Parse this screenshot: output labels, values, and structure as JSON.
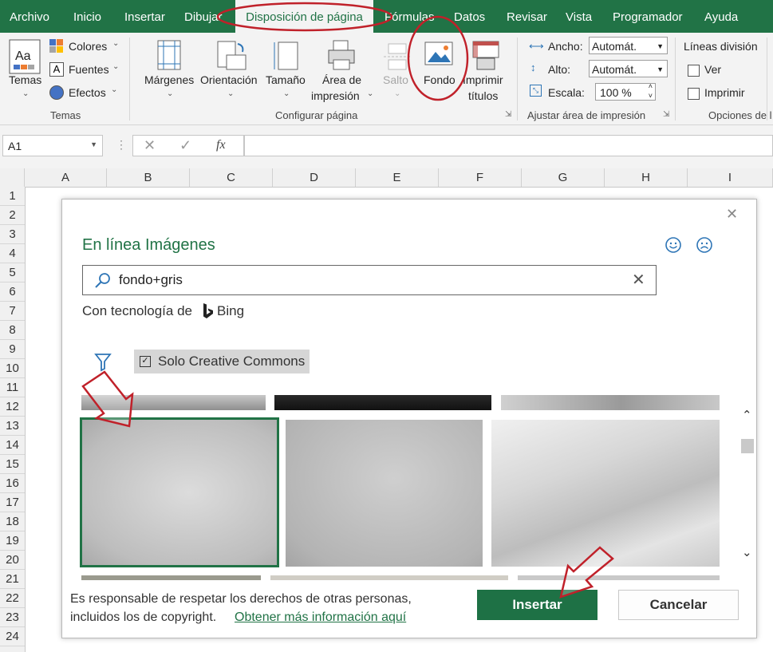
{
  "tabs": [
    "Archivo",
    "Inicio",
    "Insertar",
    "Dibujar",
    "Disposición de página",
    "Fórmulas",
    "Datos",
    "Revisar",
    "Vista",
    "Programador",
    "Ayuda"
  ],
  "ribbon": {
    "themes": {
      "label": "Temas",
      "colors": "Colores",
      "fonts": "Fuentes",
      "effects": "Efectos",
      "group": "Temas"
    },
    "page_setup": {
      "margins": "Márgenes",
      "orientation": "Orientación",
      "size": "Tamaño",
      "print_area_1": "Área de",
      "print_area_2": "impresión",
      "breaks": "Salto",
      "background": "Fondo",
      "print_titles_1": "Imprimir",
      "print_titles_2": "títulos",
      "group": "Configurar página"
    },
    "scale_fit": {
      "width_label": "Ancho:",
      "width_value": "Automát.",
      "height_label": "Alto:",
      "height_value": "Automát.",
      "scale_label": "Escala:",
      "scale_value": "100 %",
      "group": "Ajustar área de impresión"
    },
    "sheet_options": {
      "gridlines": "Líneas división",
      "view": "Ver",
      "print": "Imprimir",
      "group": "Opciones de l"
    }
  },
  "formula_bar": {
    "name_box": "A1",
    "fx": "fx"
  },
  "columns": [
    "A",
    "B",
    "C",
    "D",
    "E",
    "F",
    "G",
    "H",
    "I"
  ],
  "rows": [
    "1",
    "2",
    "3",
    "4",
    "5",
    "6",
    "7",
    "8",
    "9",
    "10",
    "11",
    "12",
    "13",
    "14",
    "15",
    "16",
    "17",
    "18",
    "19",
    "20",
    "21",
    "22",
    "23",
    "24"
  ],
  "dialog": {
    "title": "En línea Imágenes",
    "search_value": "fondo+gris",
    "powered_by": "Con tecnología de",
    "bing": "Bing",
    "cc_filter": "Solo Creative Commons",
    "disclaimer_1": "Es responsable de respetar los derechos de otras personas,",
    "disclaimer_2": "incluidos los de copyright.",
    "more_info_link": "Obtener más información aquí",
    "insert_button": "Insertar",
    "cancel_button": "Cancelar"
  },
  "colors": {
    "excel_green": "#217346",
    "annotation_red": "#c0212a",
    "insert_green": "#1e7145"
  }
}
